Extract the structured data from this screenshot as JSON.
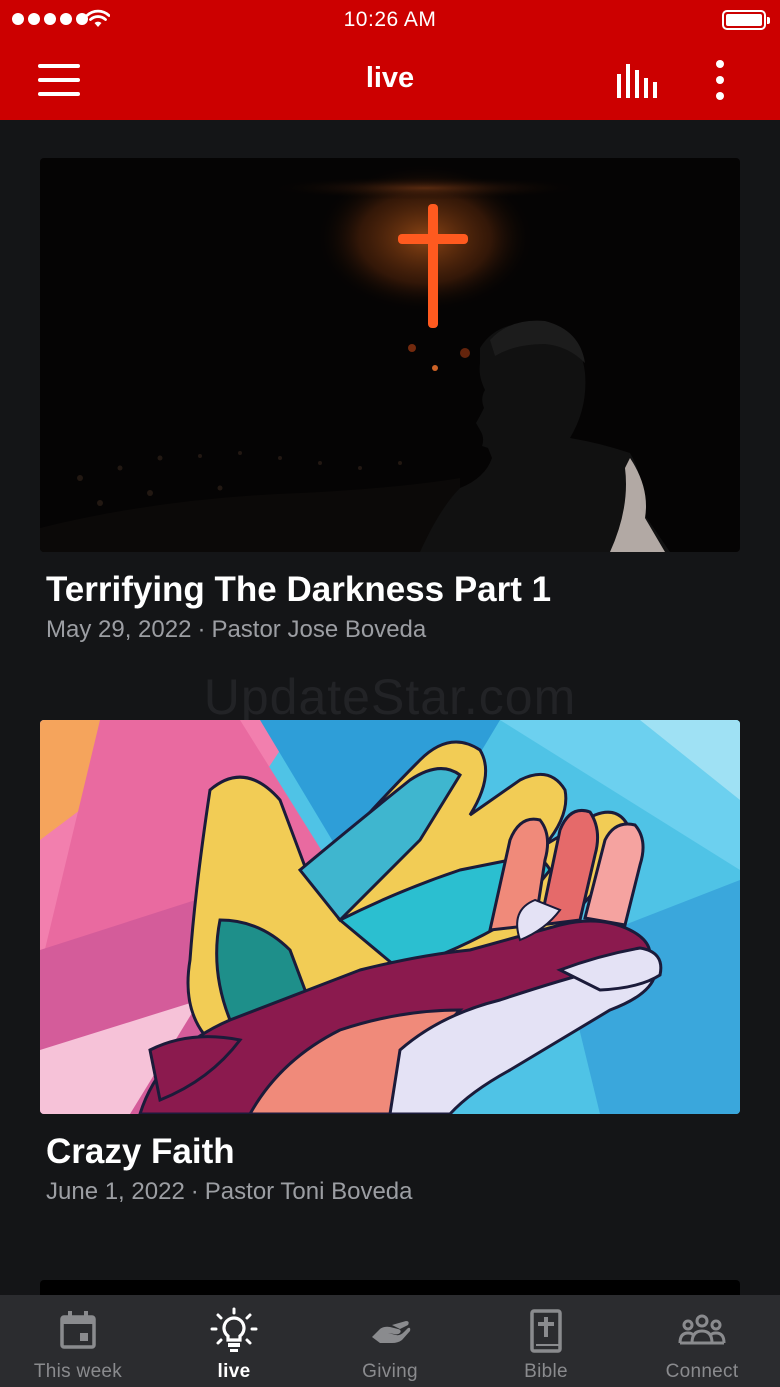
{
  "status_bar": {
    "time": "10:26 AM"
  },
  "header": {
    "title": "live",
    "background_color": "#cc0000"
  },
  "sermons": [
    {
      "title": "Terrifying The Darkness Part 1",
      "date": "May 29, 2022",
      "speaker": "Pastor Jose Boveda",
      "separator": "·"
    },
    {
      "title": "Crazy Faith",
      "date": "June 1, 2022",
      "speaker": "Pastor Toni Boveda",
      "separator": "·"
    }
  ],
  "watermark": "UpdateStar.com",
  "tabs": [
    {
      "label": "This week",
      "icon": "calendar-icon",
      "active": false
    },
    {
      "label": "live",
      "icon": "lightbulb-icon",
      "active": true
    },
    {
      "label": "Giving",
      "icon": "giving-hand-icon",
      "active": false
    },
    {
      "label": "Bible",
      "icon": "bible-icon",
      "active": false
    },
    {
      "label": "Connect",
      "icon": "people-icon",
      "active": false
    }
  ]
}
